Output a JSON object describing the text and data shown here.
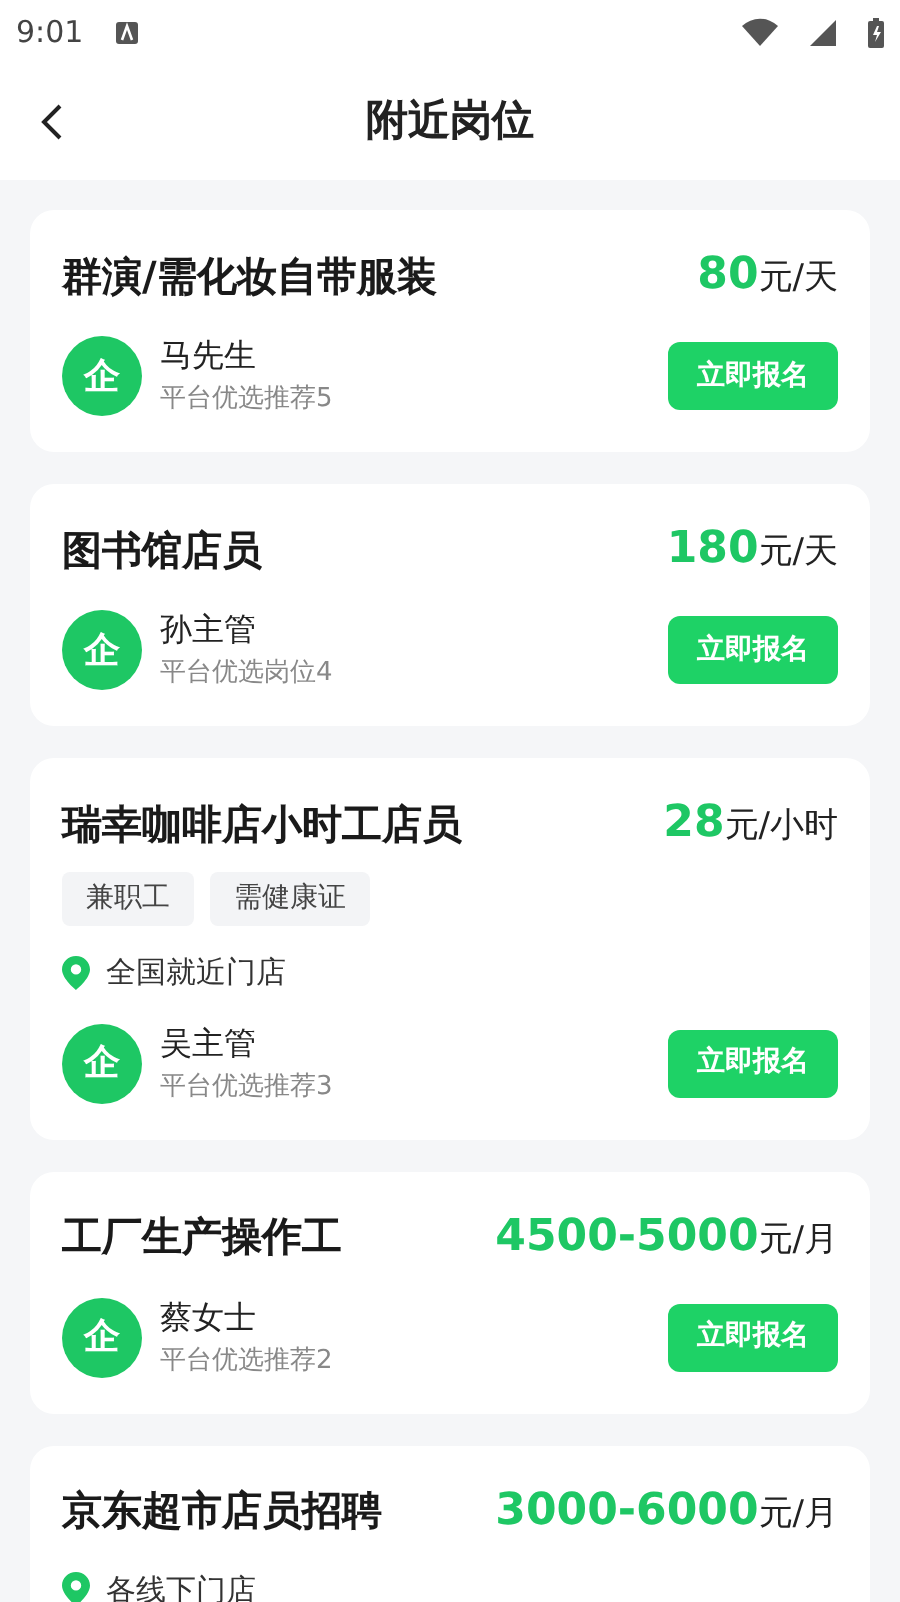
{
  "status_bar": {
    "time": "9:01"
  },
  "header": {
    "title": "附近岗位"
  },
  "jobs": [
    {
      "title": "群演/需化妆自带服装",
      "pay": "80",
      "unit": "元/天",
      "contact": {
        "badge": "企",
        "name": "马先生",
        "note": "平台优选推荐5"
      },
      "button": "立即报名"
    },
    {
      "title": "图书馆店员",
      "pay": "180",
      "unit": "元/天",
      "contact": {
        "badge": "企",
        "name": "孙主管",
        "note": "平台优选岗位4"
      },
      "button": "立即报名"
    },
    {
      "title": "瑞幸咖啡店小时工店员",
      "pay": "28",
      "unit": "元/小时",
      "tags": [
        "兼职工",
        "需健康证"
      ],
      "location": "全国就近门店",
      "contact": {
        "badge": "企",
        "name": "吴主管",
        "note": "平台优选推荐3"
      },
      "button": "立即报名"
    },
    {
      "title": "工厂生产操作工",
      "pay": "4500-5000",
      "unit": "元/月",
      "contact": {
        "badge": "企",
        "name": "蔡女士",
        "note": "平台优选推荐2"
      },
      "button": "立即报名"
    },
    {
      "title": "京东超市店员招聘",
      "pay": "3000-6000",
      "unit": "元/月",
      "location": "各线下门店"
    }
  ]
}
